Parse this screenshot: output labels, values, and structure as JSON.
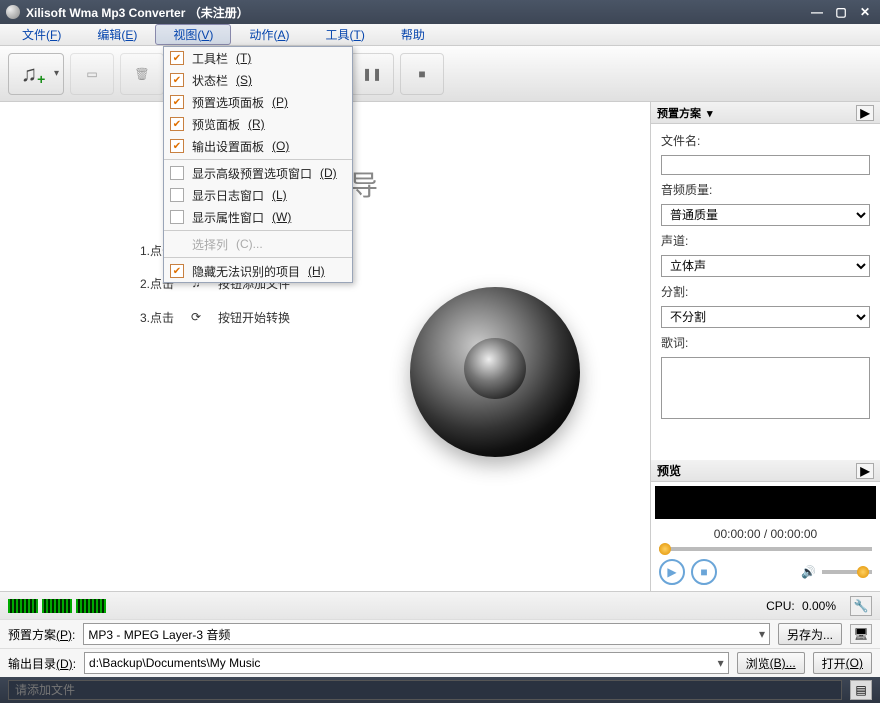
{
  "titlebar": {
    "title": "Xilisoft Wma Mp3 Converter （未注册）"
  },
  "menubar": {
    "file": "文件",
    "file_m": "F",
    "edit": "编辑",
    "edit_m": "E",
    "view": "视图",
    "view_m": "V",
    "action": "动作",
    "action_m": "A",
    "tools": "工具",
    "tools_m": "T",
    "help": "帮助"
  },
  "view_menu": {
    "toolbar": "工具栏",
    "toolbar_m": "(T)",
    "statusbar": "状态栏",
    "statusbar_m": "(S)",
    "preset_panel": "预置选项面板",
    "preset_panel_m": "(P)",
    "preview_panel": "预览面板",
    "preview_panel_m": "(R)",
    "output_panel": "输出设置面板",
    "output_panel_m": "(O)",
    "adv_preset": "显示高级预置选项窗口",
    "adv_preset_m": "(D)",
    "log_win": "显示日志窗口",
    "log_win_m": "(L)",
    "prop_win": "显示属性窗口",
    "prop_win_m": "(W)",
    "select_cols": "选择列",
    "select_cols_m": "(C)...",
    "hide_unrec": "隐藏无法识别的项目",
    "hide_unrec_m": "(H)"
  },
  "wizard": {
    "title": "用向导",
    "step1_label": "1.点击",
    "step2_label": "2.点击",
    "step2_text": "按钮添加文件",
    "step3_label": "3.点击",
    "step3_text": "按钮开始转换"
  },
  "right": {
    "preset_header": "预置方案",
    "filename_label": "文件名:",
    "quality_label": "音频质量:",
    "quality_value": "普通质量",
    "channel_label": "声道:",
    "channel_value": "立体声",
    "split_label": "分割:",
    "split_value": "不分割",
    "lyrics_label": "歌词:",
    "preview_header": "预览",
    "time": "00:00:00 / 00:00:00"
  },
  "cpu": {
    "label": "CPU:",
    "value": "0.00%"
  },
  "preset_row": {
    "label": "预置方案",
    "label_m": "(P)",
    "value": "MP3 - MPEG Layer-3 音频",
    "saveas": "另存为..."
  },
  "output_row": {
    "label": "输出目录",
    "label_m": "(D)",
    "value": "d:\\Backup\\Documents\\My Music",
    "browse": "浏览",
    "browse_m": "(B)...",
    "open": "打开",
    "open_m": "(O)"
  },
  "status": {
    "placeholder": "请添加文件"
  }
}
